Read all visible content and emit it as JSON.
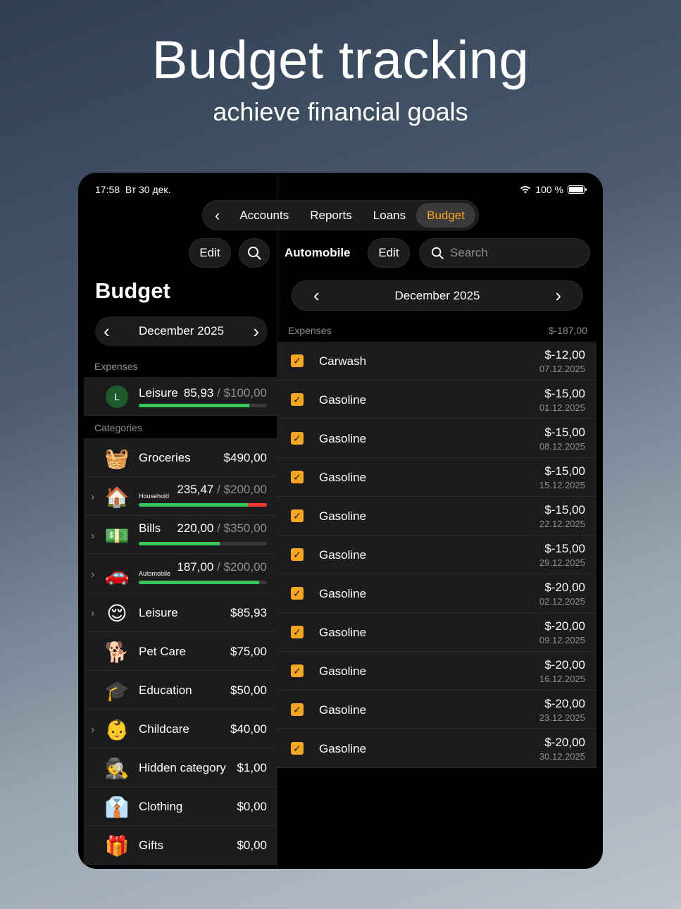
{
  "hero": {
    "title": "Budget tracking",
    "subtitle": "achieve financial goals"
  },
  "status": {
    "time": "17:58",
    "date": "Вт 30 дек.",
    "battery": "100 %"
  },
  "nav": {
    "back_icon": "chevron-left-icon",
    "items": [
      "Accounts",
      "Reports",
      "Loans",
      "Budget"
    ],
    "active": "Budget"
  },
  "left": {
    "edit_label": "Edit",
    "title": "Budget",
    "month": "December 2025",
    "expenses_header": "Expenses",
    "expense_item": {
      "avatar": "L",
      "name": "Leisure",
      "spent": "85,93",
      "limit": "/ $100,00",
      "progress": 0.86
    },
    "categories_header": "Categories",
    "categories": [
      {
        "icon": "🧺",
        "name": "Groceries",
        "amount": "$490,00",
        "expandable": false
      },
      {
        "icon": "🏠",
        "name": "Household",
        "spent": "235,47",
        "limit": "/ $200,00",
        "progress": 1.0,
        "over": 0.15,
        "expandable": true
      },
      {
        "icon": "💵",
        "name": "Bills",
        "spent": "220,00",
        "limit": "/ $350,00",
        "progress": 0.63,
        "expandable": true
      },
      {
        "icon": "🚗",
        "name": "Automobile",
        "spent": "187,00",
        "limit": "/ $200,00",
        "progress": 0.94,
        "expandable": true
      },
      {
        "icon": "😌",
        "name": "Leisure",
        "amount": "$85,93",
        "expandable": true
      },
      {
        "icon": "🐕",
        "name": "Pet Care",
        "amount": "$75,00",
        "expandable": false
      },
      {
        "icon": "🎓",
        "name": "Education",
        "amount": "$50,00",
        "expandable": false
      },
      {
        "icon": "👶",
        "name": "Childcare",
        "amount": "$40,00",
        "expandable": true
      },
      {
        "icon": "🕵️",
        "name": "Hidden category",
        "amount": "$1,00",
        "expandable": false
      },
      {
        "icon": "👔",
        "name": "Clothing",
        "amount": "$0,00",
        "expandable": false
      },
      {
        "icon": "🎁",
        "name": "Gifts",
        "amount": "$0,00",
        "expandable": false
      }
    ]
  },
  "right": {
    "title": "Automobile",
    "edit_label": "Edit",
    "search_placeholder": "Search",
    "month": "December 2025",
    "expenses_header": "Expenses",
    "total": "$-187,00",
    "expenses": [
      {
        "name": "Carwash",
        "amount": "$-12,00",
        "date": "07.12.2025"
      },
      {
        "name": "Gasoline",
        "amount": "$-15,00",
        "date": "01.12.2025"
      },
      {
        "name": "Gasoline",
        "amount": "$-15,00",
        "date": "08.12.2025"
      },
      {
        "name": "Gasoline",
        "amount": "$-15,00",
        "date": "15.12.2025"
      },
      {
        "name": "Gasoline",
        "amount": "$-15,00",
        "date": "22.12.2025"
      },
      {
        "name": "Gasoline",
        "amount": "$-15,00",
        "date": "29.12.2025"
      },
      {
        "name": "Gasoline",
        "amount": "$-20,00",
        "date": "02.12.2025"
      },
      {
        "name": "Gasoline",
        "amount": "$-20,00",
        "date": "09.12.2025"
      },
      {
        "name": "Gasoline",
        "amount": "$-20,00",
        "date": "16.12.2025"
      },
      {
        "name": "Gasoline",
        "amount": "$-20,00",
        "date": "23.12.2025"
      },
      {
        "name": "Gasoline",
        "amount": "$-20,00",
        "date": "30.12.2025"
      }
    ]
  }
}
